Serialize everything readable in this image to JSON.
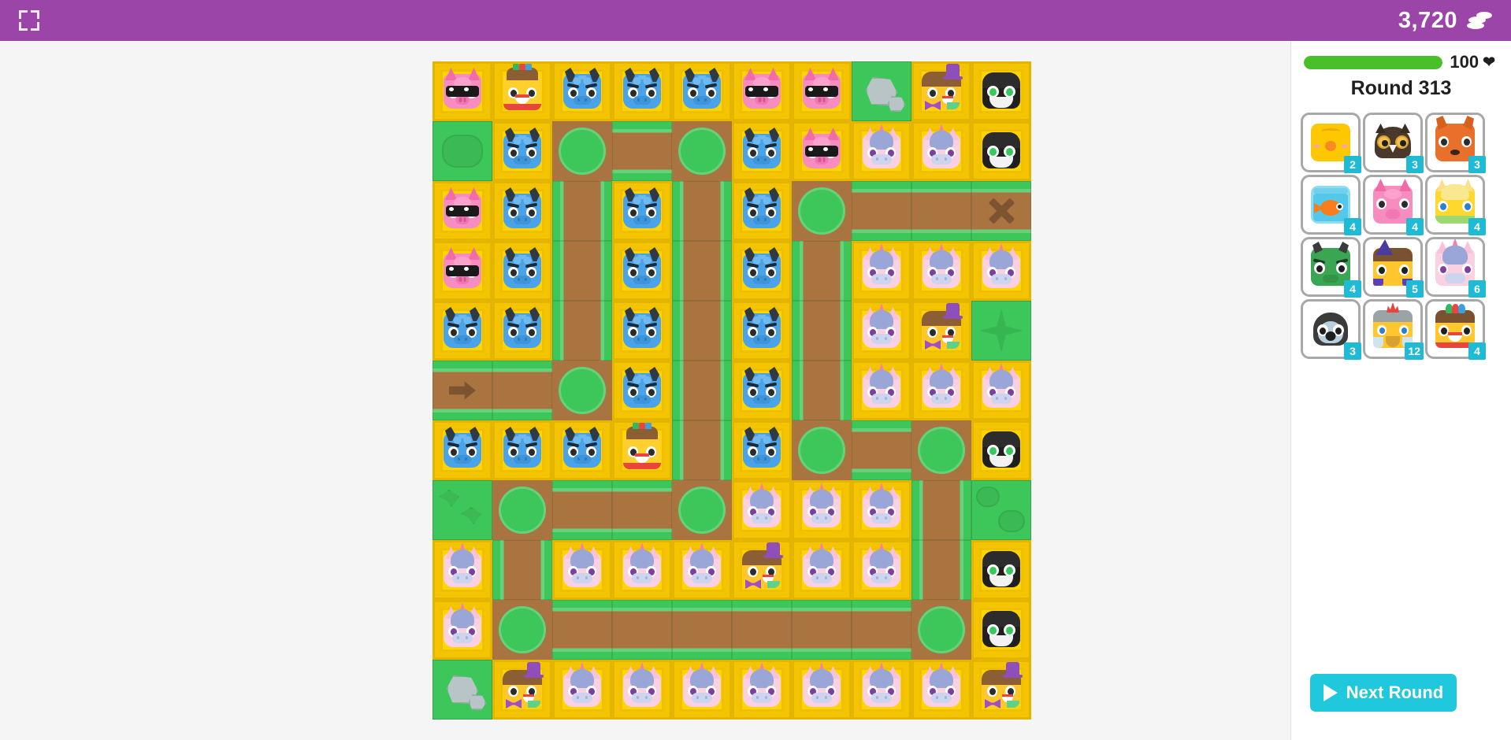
{
  "topbar": {
    "fullscreen_icon": "fullscreen-icon",
    "coin_count": "3,720",
    "coin_icon": "coins-icon"
  },
  "sidebar": {
    "health": {
      "value": 100,
      "max": 100,
      "label": "100",
      "heart_icon": "heart-icon",
      "bar_color": "#49c02b"
    },
    "round_label": "Round 313",
    "cards": [
      {
        "name": "chick",
        "cost": "2",
        "thumb": "t-chick"
      },
      {
        "name": "owl",
        "cost": "3",
        "thumb": "t-owl"
      },
      {
        "name": "fox",
        "cost": "3",
        "thumb": "t-fox"
      },
      {
        "name": "fish",
        "cost": "4",
        "thumb": "t-fish"
      },
      {
        "name": "pig",
        "cost": "4",
        "thumb": "t-pig"
      },
      {
        "name": "horse",
        "cost": "4",
        "thumb": "t-horse"
      },
      {
        "name": "dino",
        "cost": "4",
        "thumb": "t-dino"
      },
      {
        "name": "wizard",
        "cost": "5",
        "thumb": "t-wiz"
      },
      {
        "name": "unicorn",
        "cost": "6",
        "thumb": "t-unicorn"
      },
      {
        "name": "penguin",
        "cost": "3",
        "thumb": "t-peng"
      },
      {
        "name": "king",
        "cost": "12",
        "thumb": "t-king"
      },
      {
        "name": "jester",
        "cost": "4",
        "thumb": "t-jester"
      }
    ],
    "next_round_label": "Next Round",
    "next_round_icon": "play-icon",
    "next_round_color": "#1fc8dc"
  },
  "board": {
    "cols": 10,
    "rows": 11,
    "cell_size": 76,
    "colors": {
      "grass": "#3dc75a",
      "path": "#a9743f",
      "tower_frame": "#ffd400"
    },
    "markers": {
      "entry": "arrow-marker",
      "exit": "x-marker"
    },
    "cells": [
      [
        "pig",
        "jester",
        "dragon",
        "dragon",
        "dragon",
        "pig",
        "pig",
        "rock",
        "gentleman",
        "blackcat"
      ],
      [
        "bush",
        "dragon",
        "path",
        "path",
        "path",
        "dragon",
        "pig",
        "unicorn",
        "unicorn",
        "blackcat"
      ],
      [
        "pig",
        "dragon",
        "path",
        "dragon",
        "path",
        "dragon",
        "path",
        "path",
        "path",
        "exit"
      ],
      [
        "pig",
        "dragon",
        "path",
        "dragon",
        "path",
        "dragon",
        "path",
        "unicorn",
        "unicorn",
        "unicorn"
      ],
      [
        "dragon",
        "dragon",
        "path",
        "dragon",
        "path",
        "dragon",
        "path",
        "unicorn",
        "gentleman",
        "star"
      ],
      [
        "entry",
        "path",
        "path",
        "dragon",
        "path",
        "dragon",
        "path",
        "unicorn",
        "unicorn",
        "unicorn"
      ],
      [
        "dragon",
        "dragon",
        "dragon",
        "jester",
        "path",
        "dragon",
        "path",
        "path",
        "path",
        "blackcat"
      ],
      [
        "leaves",
        "path",
        "path",
        "path",
        "path",
        "unicorn",
        "unicorn",
        "unicorn",
        "path",
        "bushes"
      ],
      [
        "unicorn",
        "path",
        "unicorn",
        "unicorn",
        "unicorn",
        "gentleman",
        "unicorn",
        "unicorn",
        "path",
        "blackcat"
      ],
      [
        "unicorn",
        "path",
        "path",
        "path",
        "path",
        "path",
        "path",
        "path",
        "path",
        "blackcat"
      ],
      [
        "rock",
        "gentleman",
        "unicorn",
        "unicorn",
        "unicorn",
        "unicorn",
        "unicorn",
        "unicorn",
        "unicorn",
        "gentleman"
      ]
    ]
  }
}
